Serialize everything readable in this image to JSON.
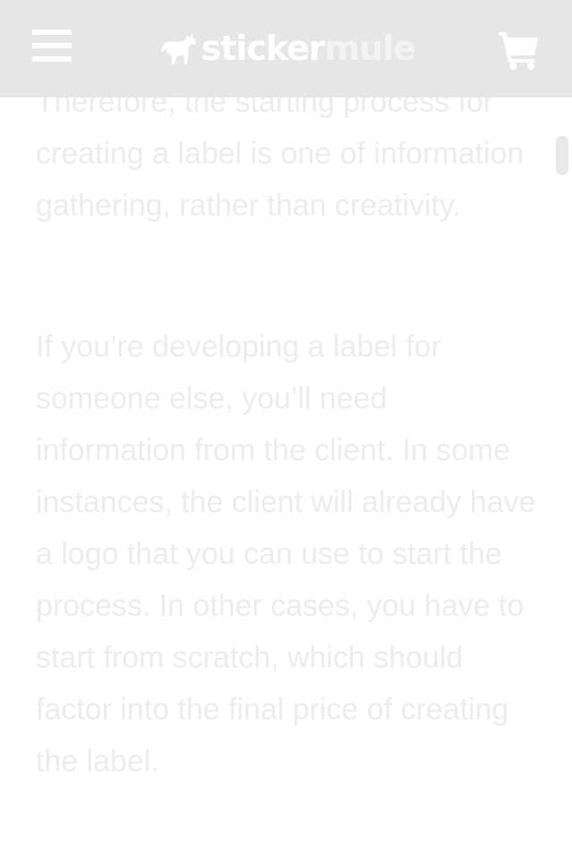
{
  "header": {
    "menu_icon": "hamburger-menu-icon",
    "logo": {
      "part1": "sticker",
      "part2": "mule",
      "icon": "mule-icon"
    },
    "cart_icon": "shopping-cart-icon",
    "background": "#e6e6e6"
  },
  "article": {
    "paragraphs": [
      "Therefore, the starting process for creating a label is one of information gathering, rather than creativity.",
      "If you’re developing a label for someone else, you’ll need information from the client. In some instances, the client will already have a logo that you can use to start the process. In other cases, you have to start from scratch, which should factor into the final price of creating the label."
    ],
    "text_color": "#ececec"
  }
}
